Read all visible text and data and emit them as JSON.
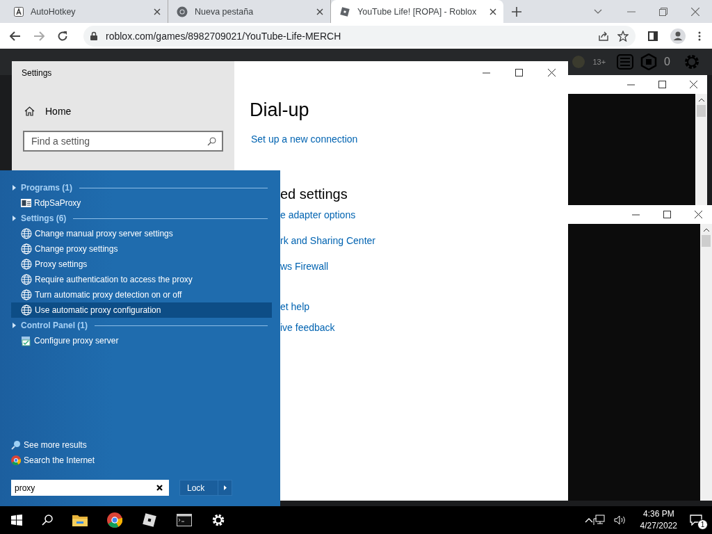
{
  "browser": {
    "tabs": [
      {
        "title": "AutoHotkey",
        "kind": "letter",
        "selected": false
      },
      {
        "title": "Nueva pestaña",
        "kind": "chrome",
        "selected": false
      },
      {
        "title": "YouTube Life! [ROPA] - Roblox",
        "kind": "roblox",
        "selected": true
      }
    ],
    "url": "roblox.com/games/8982709021/YouTube-Life-MERCH"
  },
  "page_header": {
    "age_badge": "13+",
    "robux": "0"
  },
  "settings_window": {
    "title": "Settings",
    "home": "Home",
    "search": {
      "placeholder": "Find a setting"
    },
    "heading": "Dial-up",
    "link": "Set up a new connection",
    "related_heading": "ed settings",
    "related_links": [
      "e adapter options",
      "rk and Sharing Center",
      "ws Firewall"
    ],
    "help_links": [
      "et help",
      "ive feedback"
    ]
  },
  "start_menu": {
    "groups": [
      {
        "title": "Programs (1)",
        "items": [
          {
            "label": "RdpSaProxy",
            "kind": "program",
            "selected": false
          }
        ]
      },
      {
        "title": "Settings (6)",
        "items": [
          {
            "label": "Change manual proxy server settings",
            "kind": "globe",
            "selected": false
          },
          {
            "label": "Change proxy settings",
            "kind": "globe",
            "selected": false
          },
          {
            "label": "Proxy settings",
            "kind": "globe",
            "selected": false
          },
          {
            "label": "Require authentication to access the proxy",
            "kind": "globe",
            "selected": false
          },
          {
            "label": "Turn automatic proxy detection on or off",
            "kind": "globe",
            "selected": false
          },
          {
            "label": "Use automatic proxy configuration",
            "kind": "globe",
            "selected": true
          }
        ]
      },
      {
        "title": "Control Panel (1)",
        "items": [
          {
            "label": "Configure proxy server",
            "kind": "control",
            "selected": false
          }
        ]
      }
    ],
    "see_more": "See more results",
    "search_internet": "Search the Internet",
    "search": {
      "value": "proxy"
    },
    "power_button": "Lock"
  },
  "taskbar": {
    "time": "4:36 PM",
    "date": "4/27/2022",
    "notifications": "1"
  }
}
